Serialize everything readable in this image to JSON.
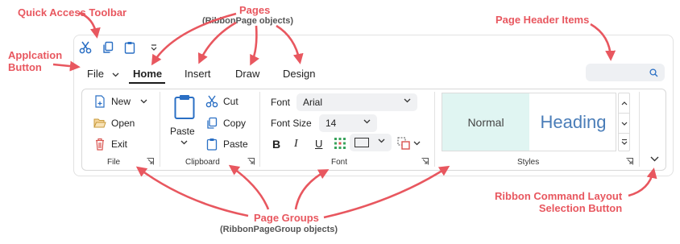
{
  "annotations": {
    "quick_access_toolbar": "Quick Access Toolbar",
    "application_button": "Applcation\nButton",
    "pages": "Pages",
    "pages_sub": "(RibbonPage objects)",
    "page_header_items": "Page Header Items",
    "page_groups": "Page Groups",
    "page_groups_sub": "(RibbonPageGroup objects)",
    "layout_selection": "Ribbon Command Layout\nSelection Button"
  },
  "ribbon": {
    "file_button": "File",
    "tabs": [
      "Home",
      "Insert",
      "Draw",
      "Design"
    ],
    "active_tab": "Home",
    "accent_color": "#e8575f",
    "groups": {
      "file": {
        "label": "File",
        "items": [
          "New",
          "Open",
          "Exit"
        ]
      },
      "clipboard": {
        "label": "Clipboard",
        "paste": "Paste",
        "items": [
          "Cut",
          "Copy",
          "Paste"
        ]
      },
      "font": {
        "label": "Font",
        "font_label": "Font",
        "font_value": "Arial",
        "size_label": "Font Size",
        "size_value": "14",
        "format_buttons": [
          "B",
          "I",
          "U"
        ]
      },
      "styles": {
        "label": "Styles",
        "items": [
          "Normal",
          "Heading"
        ]
      }
    },
    "icons": [
      "cut-icon",
      "copy-icon",
      "paste-icon",
      "customize-icon",
      "search-icon",
      "new-icon",
      "open-icon",
      "exit-icon",
      "borders-icon",
      "border-color-icon",
      "shape-outline-icon",
      "expand-icon"
    ]
  }
}
